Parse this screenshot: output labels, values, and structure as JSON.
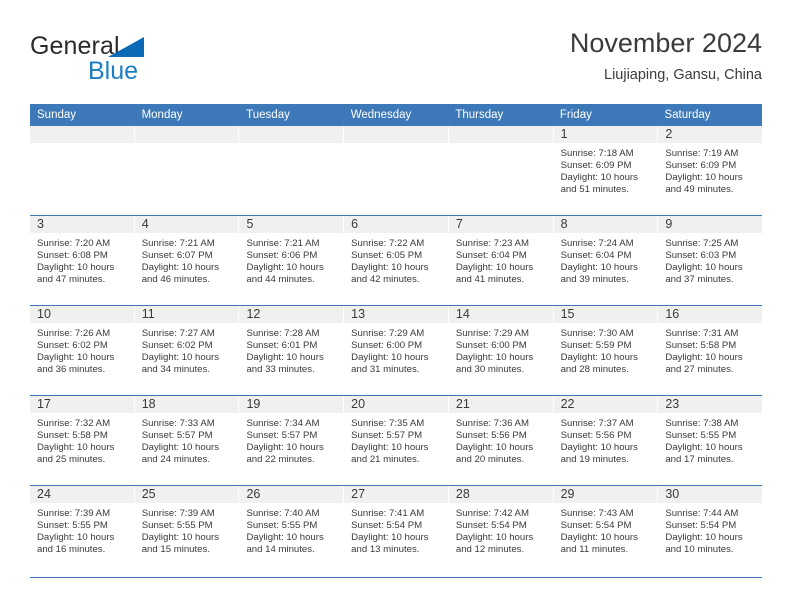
{
  "logo": {
    "text_top": "General",
    "text_bottom": "Blue",
    "triangle_icon": "triangle-icon",
    "brand_blue": "#1a7ec4",
    "triangle_color": "#0a6ab5"
  },
  "header": {
    "title": "November 2024",
    "location": "Liujiaping, Gansu, China"
  },
  "calendar": {
    "accent_color": "#3d79b8",
    "daynum_band_color": "#f0f0f0",
    "weekdays": [
      "Sunday",
      "Monday",
      "Tuesday",
      "Wednesday",
      "Thursday",
      "Friday",
      "Saturday"
    ],
    "weeks": [
      [
        {
          "day": "",
          "empty": true
        },
        {
          "day": "",
          "empty": true
        },
        {
          "day": "",
          "empty": true
        },
        {
          "day": "",
          "empty": true
        },
        {
          "day": "",
          "empty": true
        },
        {
          "day": "1",
          "sunrise": "Sunrise: 7:18 AM",
          "sunset": "Sunset: 6:09 PM",
          "daylight": "Daylight: 10 hours and 51 minutes."
        },
        {
          "day": "2",
          "sunrise": "Sunrise: 7:19 AM",
          "sunset": "Sunset: 6:09 PM",
          "daylight": "Daylight: 10 hours and 49 minutes."
        }
      ],
      [
        {
          "day": "3",
          "sunrise": "Sunrise: 7:20 AM",
          "sunset": "Sunset: 6:08 PM",
          "daylight": "Daylight: 10 hours and 47 minutes."
        },
        {
          "day": "4",
          "sunrise": "Sunrise: 7:21 AM",
          "sunset": "Sunset: 6:07 PM",
          "daylight": "Daylight: 10 hours and 46 minutes."
        },
        {
          "day": "5",
          "sunrise": "Sunrise: 7:21 AM",
          "sunset": "Sunset: 6:06 PM",
          "daylight": "Daylight: 10 hours and 44 minutes."
        },
        {
          "day": "6",
          "sunrise": "Sunrise: 7:22 AM",
          "sunset": "Sunset: 6:05 PM",
          "daylight": "Daylight: 10 hours and 42 minutes."
        },
        {
          "day": "7",
          "sunrise": "Sunrise: 7:23 AM",
          "sunset": "Sunset: 6:04 PM",
          "daylight": "Daylight: 10 hours and 41 minutes."
        },
        {
          "day": "8",
          "sunrise": "Sunrise: 7:24 AM",
          "sunset": "Sunset: 6:04 PM",
          "daylight": "Daylight: 10 hours and 39 minutes."
        },
        {
          "day": "9",
          "sunrise": "Sunrise: 7:25 AM",
          "sunset": "Sunset: 6:03 PM",
          "daylight": "Daylight: 10 hours and 37 minutes."
        }
      ],
      [
        {
          "day": "10",
          "sunrise": "Sunrise: 7:26 AM",
          "sunset": "Sunset: 6:02 PM",
          "daylight": "Daylight: 10 hours and 36 minutes."
        },
        {
          "day": "11",
          "sunrise": "Sunrise: 7:27 AM",
          "sunset": "Sunset: 6:02 PM",
          "daylight": "Daylight: 10 hours and 34 minutes."
        },
        {
          "day": "12",
          "sunrise": "Sunrise: 7:28 AM",
          "sunset": "Sunset: 6:01 PM",
          "daylight": "Daylight: 10 hours and 33 minutes."
        },
        {
          "day": "13",
          "sunrise": "Sunrise: 7:29 AM",
          "sunset": "Sunset: 6:00 PM",
          "daylight": "Daylight: 10 hours and 31 minutes."
        },
        {
          "day": "14",
          "sunrise": "Sunrise: 7:29 AM",
          "sunset": "Sunset: 6:00 PM",
          "daylight": "Daylight: 10 hours and 30 minutes."
        },
        {
          "day": "15",
          "sunrise": "Sunrise: 7:30 AM",
          "sunset": "Sunset: 5:59 PM",
          "daylight": "Daylight: 10 hours and 28 minutes."
        },
        {
          "day": "16",
          "sunrise": "Sunrise: 7:31 AM",
          "sunset": "Sunset: 5:58 PM",
          "daylight": "Daylight: 10 hours and 27 minutes."
        }
      ],
      [
        {
          "day": "17",
          "sunrise": "Sunrise: 7:32 AM",
          "sunset": "Sunset: 5:58 PM",
          "daylight": "Daylight: 10 hours and 25 minutes."
        },
        {
          "day": "18",
          "sunrise": "Sunrise: 7:33 AM",
          "sunset": "Sunset: 5:57 PM",
          "daylight": "Daylight: 10 hours and 24 minutes."
        },
        {
          "day": "19",
          "sunrise": "Sunrise: 7:34 AM",
          "sunset": "Sunset: 5:57 PM",
          "daylight": "Daylight: 10 hours and 22 minutes."
        },
        {
          "day": "20",
          "sunrise": "Sunrise: 7:35 AM",
          "sunset": "Sunset: 5:57 PM",
          "daylight": "Daylight: 10 hours and 21 minutes."
        },
        {
          "day": "21",
          "sunrise": "Sunrise: 7:36 AM",
          "sunset": "Sunset: 5:56 PM",
          "daylight": "Daylight: 10 hours and 20 minutes."
        },
        {
          "day": "22",
          "sunrise": "Sunrise: 7:37 AM",
          "sunset": "Sunset: 5:56 PM",
          "daylight": "Daylight: 10 hours and 19 minutes."
        },
        {
          "day": "23",
          "sunrise": "Sunrise: 7:38 AM",
          "sunset": "Sunset: 5:55 PM",
          "daylight": "Daylight: 10 hours and 17 minutes."
        }
      ],
      [
        {
          "day": "24",
          "sunrise": "Sunrise: 7:39 AM",
          "sunset": "Sunset: 5:55 PM",
          "daylight": "Daylight: 10 hours and 16 minutes."
        },
        {
          "day": "25",
          "sunrise": "Sunrise: 7:39 AM",
          "sunset": "Sunset: 5:55 PM",
          "daylight": "Daylight: 10 hours and 15 minutes."
        },
        {
          "day": "26",
          "sunrise": "Sunrise: 7:40 AM",
          "sunset": "Sunset: 5:55 PM",
          "daylight": "Daylight: 10 hours and 14 minutes."
        },
        {
          "day": "27",
          "sunrise": "Sunrise: 7:41 AM",
          "sunset": "Sunset: 5:54 PM",
          "daylight": "Daylight: 10 hours and 13 minutes."
        },
        {
          "day": "28",
          "sunrise": "Sunrise: 7:42 AM",
          "sunset": "Sunset: 5:54 PM",
          "daylight": "Daylight: 10 hours and 12 minutes."
        },
        {
          "day": "29",
          "sunrise": "Sunrise: 7:43 AM",
          "sunset": "Sunset: 5:54 PM",
          "daylight": "Daylight: 10 hours and 11 minutes."
        },
        {
          "day": "30",
          "sunrise": "Sunrise: 7:44 AM",
          "sunset": "Sunset: 5:54 PM",
          "daylight": "Daylight: 10 hours and 10 minutes."
        }
      ]
    ]
  }
}
